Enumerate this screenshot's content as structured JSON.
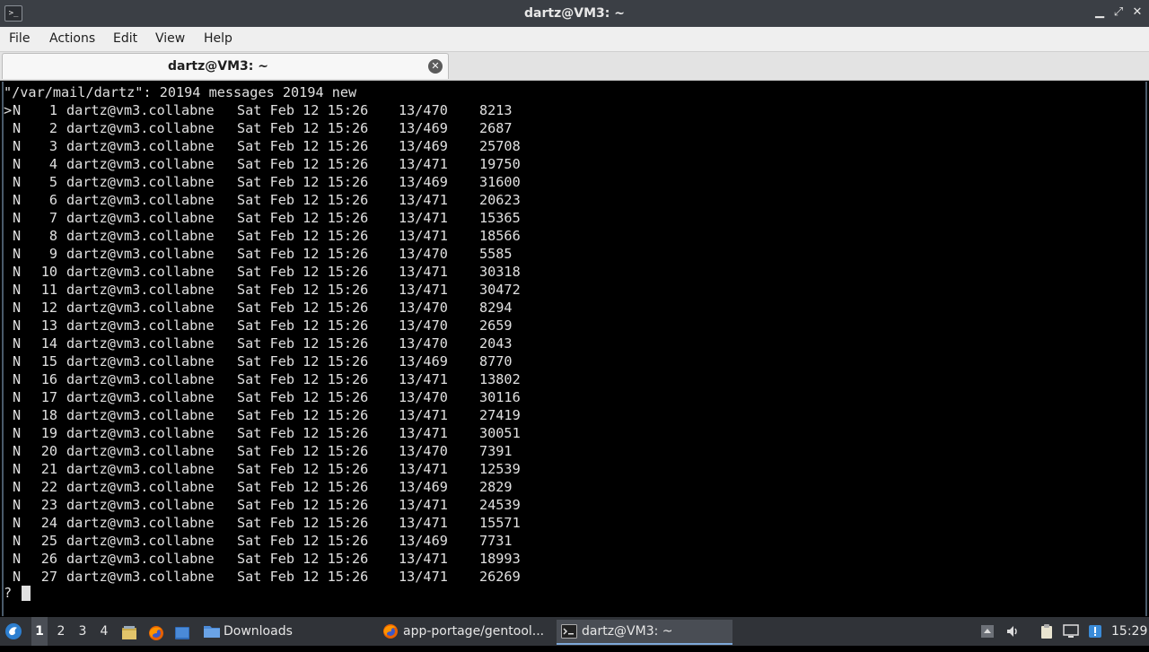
{
  "window": {
    "title": "dartz@VM3: ~",
    "app_icon_glyph": ">_",
    "minimize_glyph": "▁",
    "maximize_glyph": "⤢",
    "close_glyph": "✕"
  },
  "menubar": {
    "items": [
      "File",
      "Actions",
      "Edit",
      "View",
      "Help"
    ]
  },
  "tabs": [
    {
      "label": "dartz@VM3: ~",
      "close_glyph": "✕"
    }
  ],
  "terminal": {
    "header_line": "\"/var/mail/dartz\": 20194 messages 20194 new",
    "messages": [
      {
        "marker": ">",
        "status": "N",
        "num": "1",
        "from": "dartz@vm3.collabne",
        "date": "Sat Feb 12 15:26",
        "lines": "13/470",
        "size": "8213"
      },
      {
        "marker": "",
        "status": "N",
        "num": "2",
        "from": "dartz@vm3.collabne",
        "date": "Sat Feb 12 15:26",
        "lines": "13/469",
        "size": "2687"
      },
      {
        "marker": "",
        "status": "N",
        "num": "3",
        "from": "dartz@vm3.collabne",
        "date": "Sat Feb 12 15:26",
        "lines": "13/469",
        "size": "25708"
      },
      {
        "marker": "",
        "status": "N",
        "num": "4",
        "from": "dartz@vm3.collabne",
        "date": "Sat Feb 12 15:26",
        "lines": "13/471",
        "size": "19750"
      },
      {
        "marker": "",
        "status": "N",
        "num": "5",
        "from": "dartz@vm3.collabne",
        "date": "Sat Feb 12 15:26",
        "lines": "13/469",
        "size": "31600"
      },
      {
        "marker": "",
        "status": "N",
        "num": "6",
        "from": "dartz@vm3.collabne",
        "date": "Sat Feb 12 15:26",
        "lines": "13/471",
        "size": "20623"
      },
      {
        "marker": "",
        "status": "N",
        "num": "7",
        "from": "dartz@vm3.collabne",
        "date": "Sat Feb 12 15:26",
        "lines": "13/471",
        "size": "15365"
      },
      {
        "marker": "",
        "status": "N",
        "num": "8",
        "from": "dartz@vm3.collabne",
        "date": "Sat Feb 12 15:26",
        "lines": "13/471",
        "size": "18566"
      },
      {
        "marker": "",
        "status": "N",
        "num": "9",
        "from": "dartz@vm3.collabne",
        "date": "Sat Feb 12 15:26",
        "lines": "13/470",
        "size": "5585"
      },
      {
        "marker": "",
        "status": "N",
        "num": "10",
        "from": "dartz@vm3.collabne",
        "date": "Sat Feb 12 15:26",
        "lines": "13/471",
        "size": "30318"
      },
      {
        "marker": "",
        "status": "N",
        "num": "11",
        "from": "dartz@vm3.collabne",
        "date": "Sat Feb 12 15:26",
        "lines": "13/471",
        "size": "30472"
      },
      {
        "marker": "",
        "status": "N",
        "num": "12",
        "from": "dartz@vm3.collabne",
        "date": "Sat Feb 12 15:26",
        "lines": "13/470",
        "size": "8294"
      },
      {
        "marker": "",
        "status": "N",
        "num": "13",
        "from": "dartz@vm3.collabne",
        "date": "Sat Feb 12 15:26",
        "lines": "13/470",
        "size": "2659"
      },
      {
        "marker": "",
        "status": "N",
        "num": "14",
        "from": "dartz@vm3.collabne",
        "date": "Sat Feb 12 15:26",
        "lines": "13/470",
        "size": "2043"
      },
      {
        "marker": "",
        "status": "N",
        "num": "15",
        "from": "dartz@vm3.collabne",
        "date": "Sat Feb 12 15:26",
        "lines": "13/469",
        "size": "8770"
      },
      {
        "marker": "",
        "status": "N",
        "num": "16",
        "from": "dartz@vm3.collabne",
        "date": "Sat Feb 12 15:26",
        "lines": "13/471",
        "size": "13802"
      },
      {
        "marker": "",
        "status": "N",
        "num": "17",
        "from": "dartz@vm3.collabne",
        "date": "Sat Feb 12 15:26",
        "lines": "13/470",
        "size": "30116"
      },
      {
        "marker": "",
        "status": "N",
        "num": "18",
        "from": "dartz@vm3.collabne",
        "date": "Sat Feb 12 15:26",
        "lines": "13/471",
        "size": "27419"
      },
      {
        "marker": "",
        "status": "N",
        "num": "19",
        "from": "dartz@vm3.collabne",
        "date": "Sat Feb 12 15:26",
        "lines": "13/471",
        "size": "30051"
      },
      {
        "marker": "",
        "status": "N",
        "num": "20",
        "from": "dartz@vm3.collabne",
        "date": "Sat Feb 12 15:26",
        "lines": "13/470",
        "size": "7391"
      },
      {
        "marker": "",
        "status": "N",
        "num": "21",
        "from": "dartz@vm3.collabne",
        "date": "Sat Feb 12 15:26",
        "lines": "13/471",
        "size": "12539"
      },
      {
        "marker": "",
        "status": "N",
        "num": "22",
        "from": "dartz@vm3.collabne",
        "date": "Sat Feb 12 15:26",
        "lines": "13/469",
        "size": "2829"
      },
      {
        "marker": "",
        "status": "N",
        "num": "23",
        "from": "dartz@vm3.collabne",
        "date": "Sat Feb 12 15:26",
        "lines": "13/471",
        "size": "24539"
      },
      {
        "marker": "",
        "status": "N",
        "num": "24",
        "from": "dartz@vm3.collabne",
        "date": "Sat Feb 12 15:26",
        "lines": "13/471",
        "size": "15571"
      },
      {
        "marker": "",
        "status": "N",
        "num": "25",
        "from": "dartz@vm3.collabne",
        "date": "Sat Feb 12 15:26",
        "lines": "13/469",
        "size": "7731"
      },
      {
        "marker": "",
        "status": "N",
        "num": "26",
        "from": "dartz@vm3.collabne",
        "date": "Sat Feb 12 15:26",
        "lines": "13/471",
        "size": "18993"
      },
      {
        "marker": "",
        "status": "N",
        "num": "27",
        "from": "dartz@vm3.collabne",
        "date": "Sat Feb 12 15:26",
        "lines": "13/471",
        "size": "26269"
      }
    ],
    "prompt": "?"
  },
  "taskbar": {
    "workspaces": [
      "1",
      "2",
      "3",
      "4"
    ],
    "active_workspace": "1",
    "tasks": [
      {
        "label": "Downloads",
        "icon": "folder-icon"
      },
      {
        "label": "app-portage/gentool...",
        "icon": "firefox-icon"
      },
      {
        "label": "dartz@VM3: ~",
        "icon": "terminal-icon"
      }
    ],
    "clock": "15:29"
  },
  "colors": {
    "titlebar": "#3b3f45",
    "menubar": "#efefef",
    "terminal_bg": "#000000",
    "terminal_fg": "#e0e0e0",
    "taskbar": "#303338",
    "accent": "#7ea8d8"
  }
}
